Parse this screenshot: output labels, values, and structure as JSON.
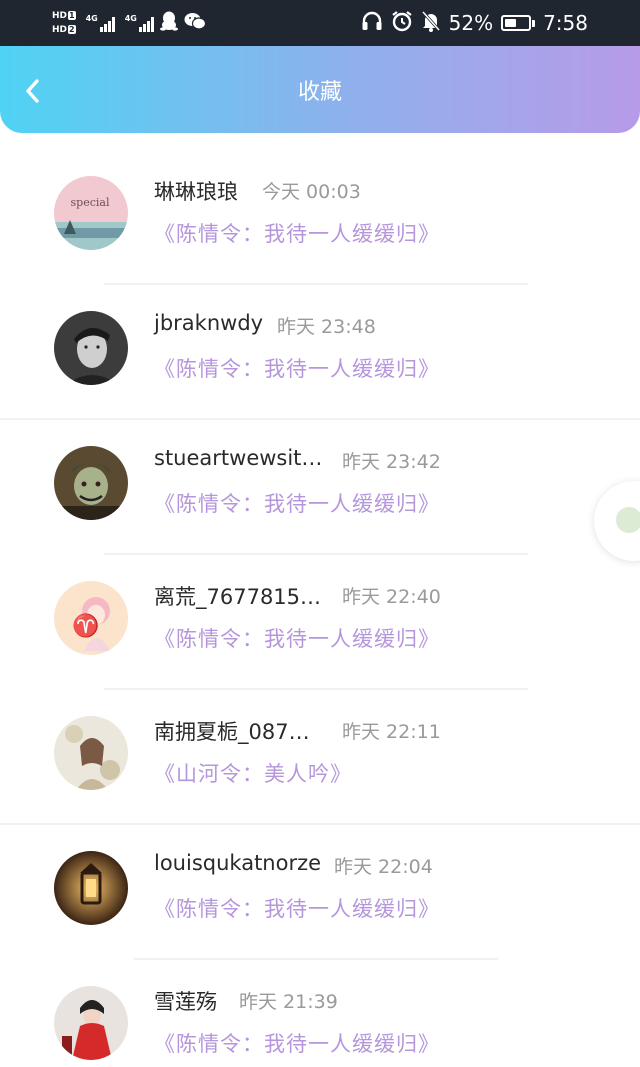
{
  "status_bar": {
    "hd1": "HD",
    "hd1_num": "1",
    "hd2": "HD",
    "hd2_num": "2",
    "net1": "4G",
    "net2": "4G",
    "battery_percent": "52%",
    "battery_level": 0.52,
    "time": "7:58",
    "icons": [
      "penguin-icon",
      "wechat-icon",
      "headphones-icon",
      "alarm-icon",
      "mute-bell-icon",
      "battery-icon"
    ]
  },
  "header": {
    "title": "收藏",
    "back_icon": "chevron-left-icon",
    "gradient": [
      "#4fd3f4",
      "#b79be8"
    ]
  },
  "colors": {
    "work_title": "#b596dc",
    "time": "#9a9a9a",
    "name": "#2a2a2a"
  },
  "items": [
    {
      "name": "琳琳琅琅",
      "time": "今天 00:03",
      "work": "《陈情令：我待一人缓缓归》"
    },
    {
      "name": "jbraknwdy",
      "time": "昨天 23:48",
      "work": "《陈情令：我待一人缓缓归》"
    },
    {
      "name": "stueartwewsit…",
      "time": "昨天 23:42",
      "work": "《陈情令：我待一人缓缓归》"
    },
    {
      "name": "离荒_7677815…",
      "time": "昨天 22:40",
      "work": "《陈情令：我待一人缓缓归》"
    },
    {
      "name": "南拥夏栀_087…",
      "time": "昨天 22:11",
      "work": "《山河令：美人吟》"
    },
    {
      "name": "louisqukatnorze",
      "time": "昨天 22:04",
      "work": "《陈情令：我待一人缓缓归》"
    },
    {
      "name": "雪莲殇",
      "time": "昨天 21:39",
      "work": "《陈情令：我待一人缓缓归》"
    }
  ]
}
